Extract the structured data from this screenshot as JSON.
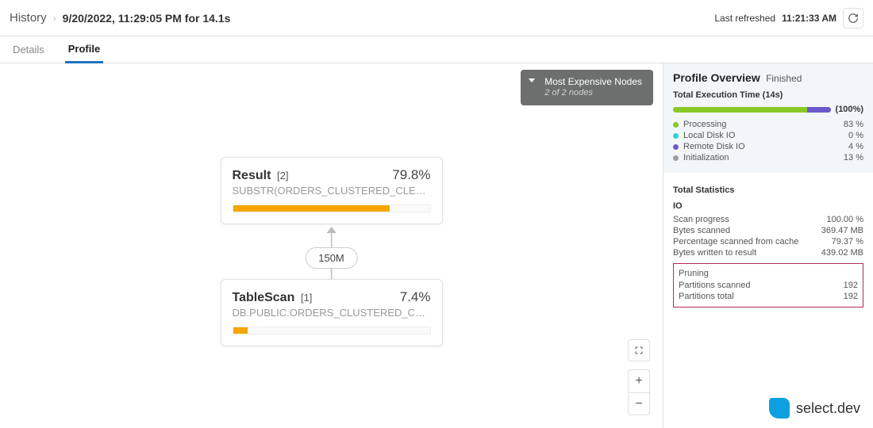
{
  "header": {
    "history": "History",
    "timestamp": "9/20/2022, 11:29:05 PM for 14.1s",
    "last_refreshed_label": "Last refreshed",
    "last_refreshed_time": "11:21:33 AM"
  },
  "tabs": {
    "details": "Details",
    "profile": "Profile"
  },
  "expensive": {
    "title": "Most Expensive Nodes",
    "sub": "2 of 2 nodes"
  },
  "nodes": [
    {
      "name": "Result",
      "idx": "[2]",
      "pct": "79.8%",
      "detail": "SUBSTR(ORDERS_CLUSTERED_CLERK_AU…",
      "bar_pct": 79.8
    },
    {
      "name": "TableScan",
      "idx": "[1]",
      "pct": "7.4%",
      "detail": "DB.PUBLIC.ORDERS_CLUSTERED_CLERK_A…",
      "bar_pct": 7.4
    }
  ],
  "edge": {
    "label": "150M"
  },
  "overview": {
    "title": "Profile Overview",
    "status": "Finished",
    "exec_label": "Total Execution Time (14s)",
    "total_pct": "(100%)",
    "breakdown": [
      {
        "label": "Processing",
        "value": "83 %",
        "color": "#8ac926"
      },
      {
        "label": "Local Disk IO",
        "value": "0 %",
        "color": "#2ad4d4"
      },
      {
        "label": "Remote Disk IO",
        "value": "4 %",
        "color": "#6a5acd"
      },
      {
        "label": "Initialization",
        "value": "13 %",
        "color": "#9e9e9e"
      }
    ]
  },
  "stats": {
    "title": "Total Statistics",
    "io_title": "IO",
    "io": [
      {
        "label": "Scan progress",
        "value": "100.00 %"
      },
      {
        "label": "Bytes scanned",
        "value": "369.47 MB"
      },
      {
        "label": "Percentage scanned from cache",
        "value": "79.37 %"
      },
      {
        "label": "Bytes written to result",
        "value": "439.02 MB"
      }
    ],
    "pruning_title": "Pruning",
    "pruning": [
      {
        "label": "Partitions scanned",
        "value": "192"
      },
      {
        "label": "Partitions total",
        "value": "192"
      }
    ]
  },
  "logo": "select.dev"
}
